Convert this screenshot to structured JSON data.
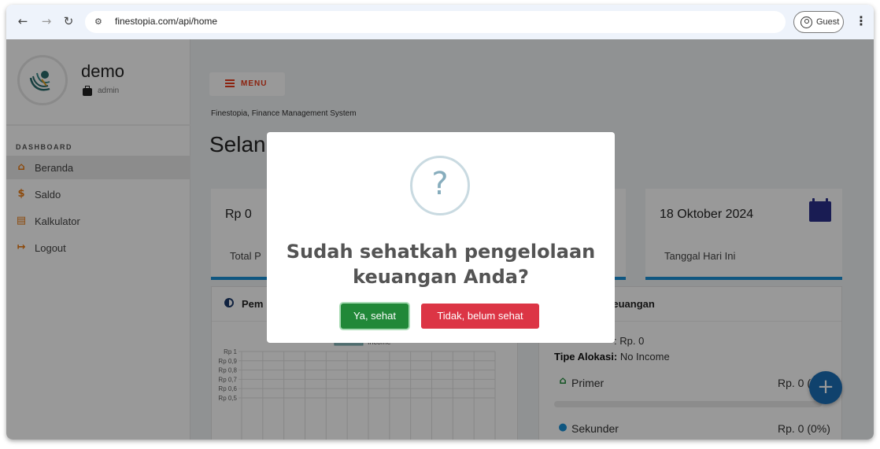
{
  "browser": {
    "url": "finestopia.com/api/home",
    "profile_label": "Guest"
  },
  "sidebar": {
    "user_name": "demo",
    "user_role": "admin",
    "section_label": "DASHBOARD",
    "items": [
      {
        "label": "Beranda",
        "icon": "home-icon",
        "active": true
      },
      {
        "label": "Saldo",
        "icon": "dollar-icon"
      },
      {
        "label": "Kalkulator",
        "icon": "calculator-icon"
      },
      {
        "label": "Logout",
        "icon": "logout-icon"
      }
    ]
  },
  "header": {
    "menu_label": "MENU",
    "system_name": "Finestopia, Finance Management System",
    "welcome_partial": "Selan"
  },
  "cards": {
    "total": {
      "value": "Rp 0",
      "label_partial": "Total P"
    },
    "date": {
      "value": "18 Oktober 2024",
      "label": "Tanggal Hari Ini"
    }
  },
  "chart_panel": {
    "title_partial": "Pem"
  },
  "chart_data": {
    "type": "bar",
    "title": "",
    "legend": [
      "Income"
    ],
    "y_tick_labels": [
      "Rp 1",
      "Rp 0,9",
      "Rp 0,8",
      "Rp 0,7",
      "Rp 0,6",
      "Rp 0,5"
    ],
    "ylim": [
      0,
      1
    ],
    "series": [
      {
        "name": "Income",
        "values": []
      }
    ],
    "legend_color": "#8fbfc1"
  },
  "allocation_panel": {
    "title_partial": "Keuangan",
    "amount_partial": ": Rp. 0",
    "type_label": "Tipe Alokasi:",
    "type_value": "No Income",
    "rows": [
      {
        "label": "Primer",
        "value_partial": "Rp. 0 (",
        "icon": "home-icon",
        "progress": 0
      },
      {
        "label": "Sekunder",
        "value": "Rp. 0 (0%)",
        "icon": "user-icon"
      }
    ]
  },
  "modal": {
    "title": "Sudah sehatkah pengelolaan keuangan Anda?",
    "icon": "question-icon",
    "confirm_label": "Ya, sehat",
    "cancel_label": "Tidak, belum sehat"
  },
  "colors": {
    "accent_orange": "#ea7a13",
    "menu_red": "#ea3a1a",
    "card_border_blue": "#1a8fd6",
    "confirm_green": "#218838",
    "cancel_red": "#dc3545",
    "fab_blue": "#1c6fb6",
    "calendar_navy": "#2b2f8a"
  }
}
